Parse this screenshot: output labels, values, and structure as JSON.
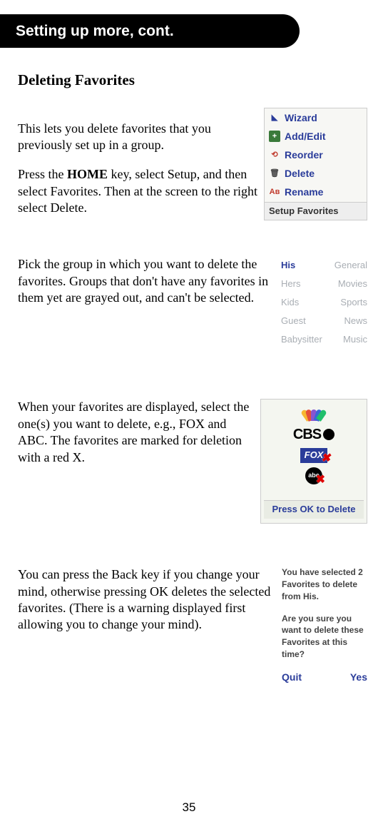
{
  "header": "Setting up more, cont.",
  "title": "Deleting Favorites",
  "para1": "This lets you delete favorites that you previously set up in a group.",
  "para2a": "Press the ",
  "para2home": "HOME",
  "para2b": " key, select Setup, and then select Favorites. Then at the screen to the right select Delete.",
  "para3": "Pick the group in which you want to delete the favorites. Groups that don't have any favorites in them yet are grayed out, and can't be selected.",
  "para4": "When your favorites are displayed, select the one(s) you want to delete, e.g., FOX and ABC. The favorites are marked for deletion with a red X.",
  "para5": "You can press the Back key if you change your mind, otherwise pressing OK deletes the selected favorites. (There is a warning displayed first allowing you to change your mind).",
  "page_num": "35",
  "menu": {
    "items": [
      "Wizard",
      "Add/Edit",
      "Reorder",
      "Delete",
      "Rename"
    ],
    "title": "Setup Favorites"
  },
  "groups": {
    "left": [
      "His",
      "Hers",
      "Kids",
      "Guest",
      "Babysitter"
    ],
    "right": [
      "General",
      "Movies",
      "Sports",
      "News",
      "Music"
    ]
  },
  "logos": {
    "press": "Press OK to Delete"
  },
  "confirm": {
    "line1": "You have selected 2 Favorites to delete from His.",
    "line2": "Are you sure you want to delete these Favorites at this time?",
    "quit": "Quit",
    "yes": "Yes"
  }
}
